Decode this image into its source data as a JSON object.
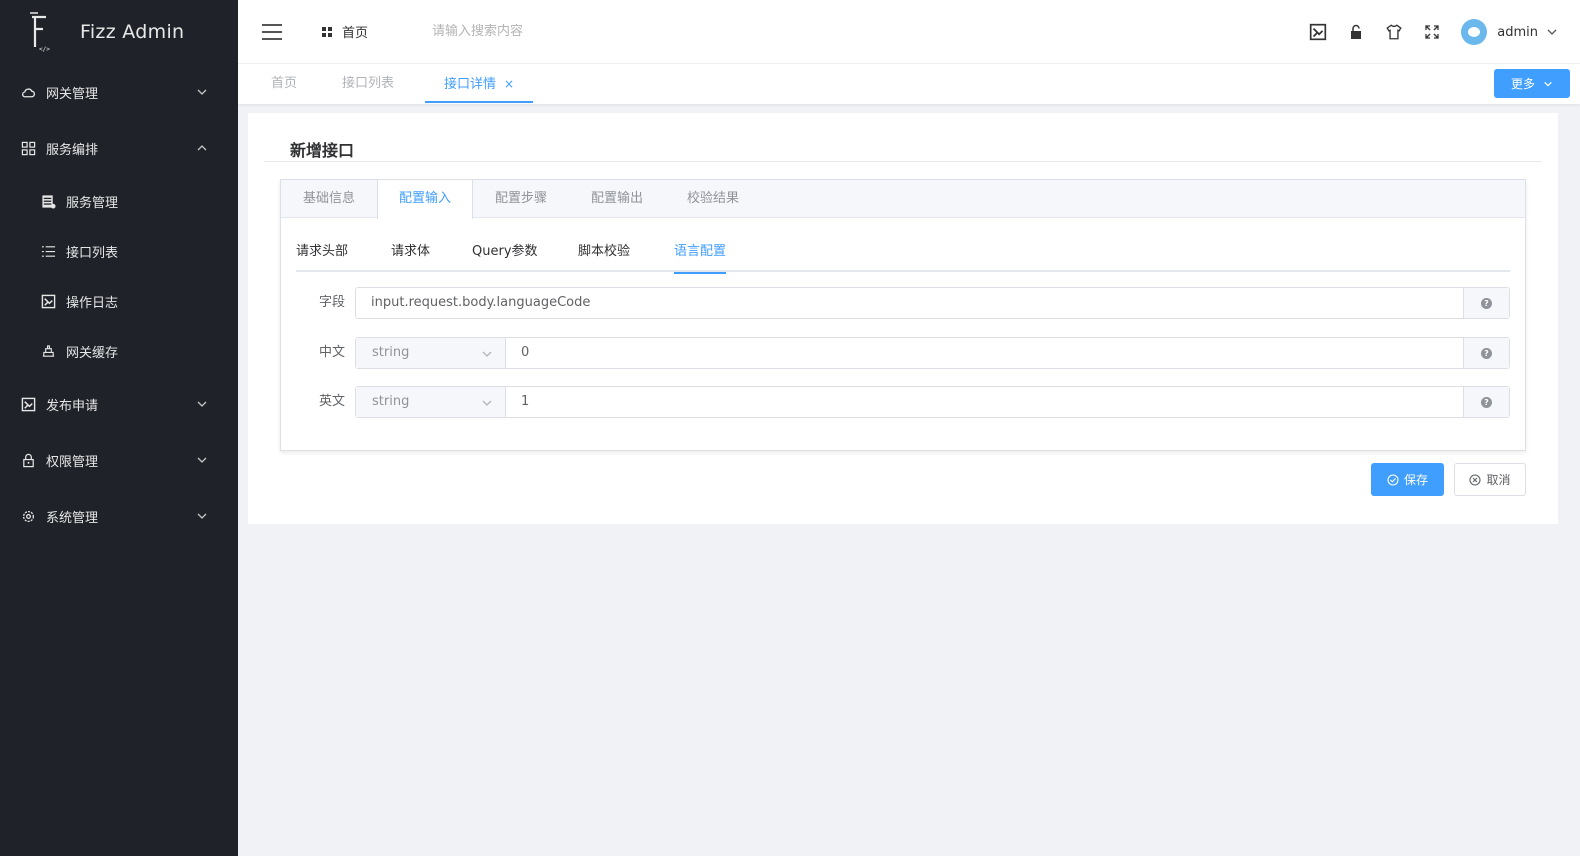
{
  "app": {
    "title": "Fizz Admin"
  },
  "sidebar": {
    "items": [
      {
        "label": "网关管理",
        "icon": "cloud-icon",
        "expanded": false
      },
      {
        "label": "服务编排",
        "icon": "grid-icon",
        "expanded": true,
        "children": [
          {
            "label": "服务管理",
            "icon": "server-icon"
          },
          {
            "label": "接口列表",
            "icon": "list-icon"
          },
          {
            "label": "操作日志",
            "icon": "log-icon"
          },
          {
            "label": "网关缓存",
            "icon": "cache-icon"
          }
        ]
      },
      {
        "label": "发布申请",
        "icon": "publish-icon",
        "expanded": false
      },
      {
        "label": "权限管理",
        "icon": "lock-icon",
        "expanded": false
      },
      {
        "label": "系统管理",
        "icon": "gear-icon",
        "expanded": false
      }
    ]
  },
  "header": {
    "home_label": "首页",
    "search_placeholder": "请输入搜索内容",
    "username": "admin"
  },
  "tagsbar": {
    "tags": [
      {
        "label": "首页",
        "active": false
      },
      {
        "label": "接口列表",
        "active": false
      },
      {
        "label": "接口详情",
        "active": true,
        "closable": true
      }
    ],
    "close_glyph": "×",
    "more_label": "更多"
  },
  "card": {
    "title": "新增接口",
    "tabs": [
      "基础信息",
      "配置输入",
      "配置步骤",
      "配置输出",
      "校验结果"
    ],
    "active_tab": 1,
    "subtabs": [
      "请求头部",
      "请求体",
      "Query参数",
      "脚本校验",
      "语言配置"
    ],
    "active_subtab": 4,
    "rows": [
      {
        "label": "字段",
        "value": "input.request.body.languageCode"
      },
      {
        "label": "中文",
        "type": "string",
        "value": "0"
      },
      {
        "label": "英文",
        "type": "string",
        "value": "1"
      }
    ],
    "help_glyph": "?",
    "save_label": "保存",
    "cancel_label": "取消"
  },
  "colors": {
    "accent": "#409eff",
    "sidebar_bg": "#1f2329",
    "page_bg": "#f0f2f5"
  }
}
